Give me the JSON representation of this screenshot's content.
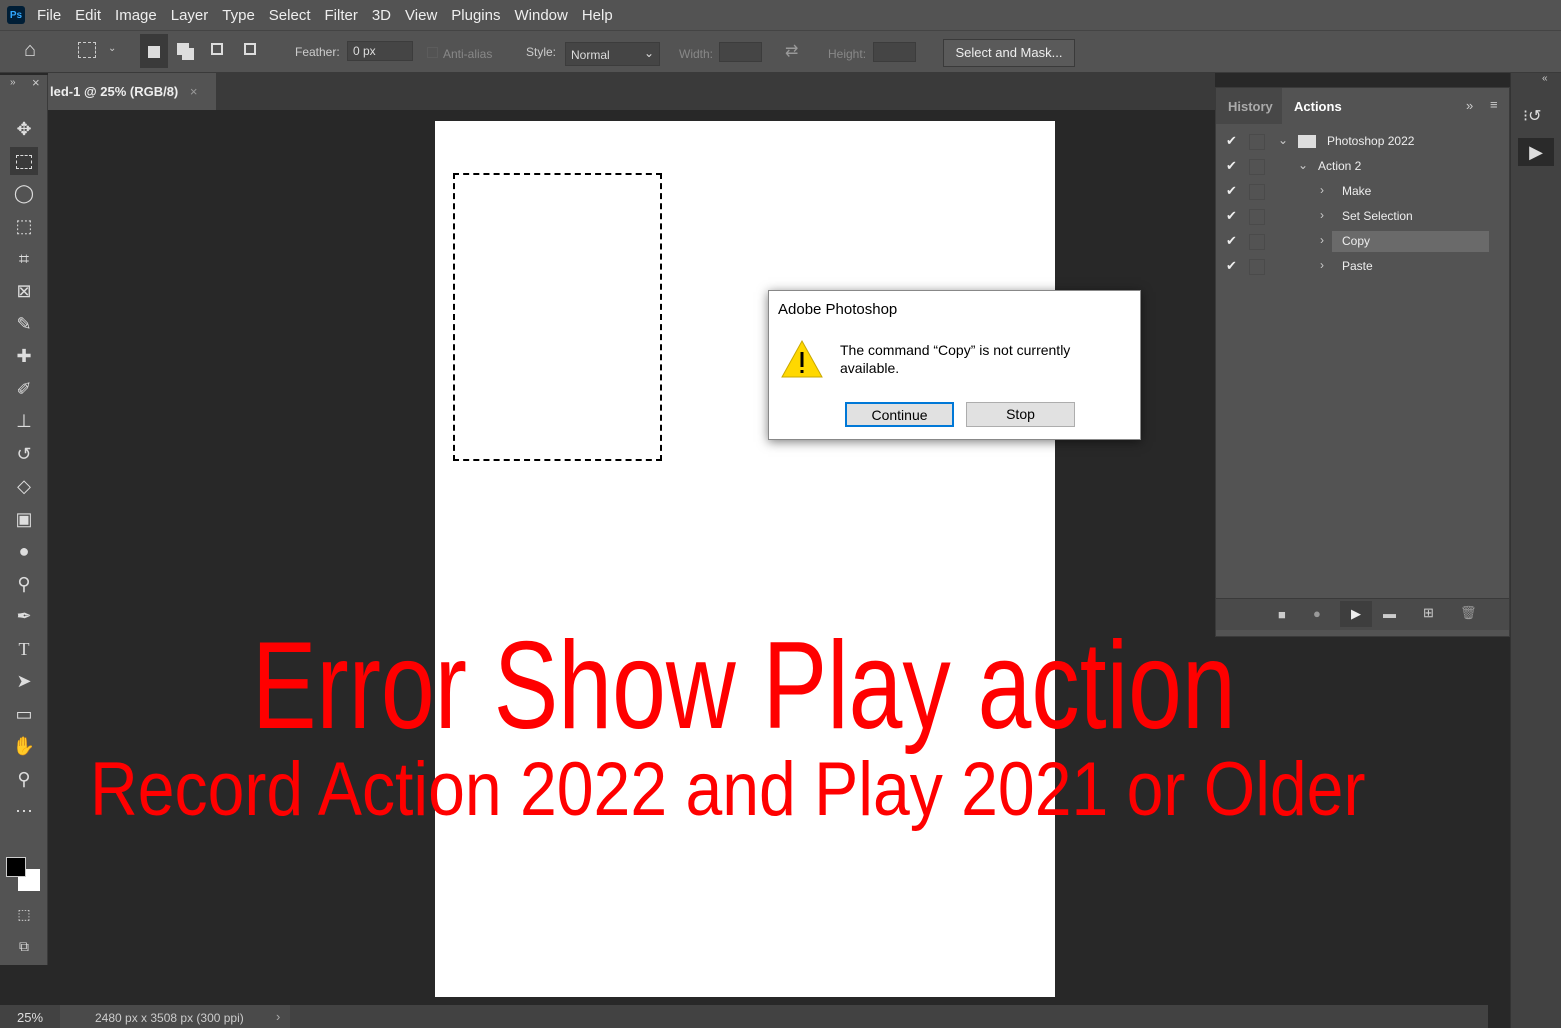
{
  "menu": [
    "File",
    "Edit",
    "Image",
    "Layer",
    "Type",
    "Select",
    "Filter",
    "3D",
    "View",
    "Plugins",
    "Window",
    "Help"
  ],
  "app_badge": "Ps",
  "options": {
    "feather_label": "Feather:",
    "feather_value": "0 px",
    "antialias_label": "Anti-alias",
    "style_label": "Style:",
    "style_value": "Normal",
    "width_label": "Width:",
    "height_label": "Height:",
    "select_mask": "Select and Mask..."
  },
  "document_tab": {
    "title": "led-1 @ 25% (RGB/8)",
    "close": "×"
  },
  "panel": {
    "tabs": [
      "History",
      "Actions"
    ],
    "items": [
      {
        "label": "Photoshop 2022",
        "level": 0,
        "expanded": true,
        "type": "set"
      },
      {
        "label": "Action 2",
        "level": 1,
        "expanded": true,
        "type": "action"
      },
      {
        "label": "Make",
        "level": 2,
        "type": "command"
      },
      {
        "label": "Set Selection",
        "level": 2,
        "type": "command"
      },
      {
        "label": "Copy",
        "level": 2,
        "type": "command",
        "selected": true
      },
      {
        "label": "Paste",
        "level": 2,
        "type": "command"
      }
    ]
  },
  "dialog": {
    "title": "Adobe Photoshop",
    "message": "The command “Copy” is not currently available.",
    "continue": "Continue",
    "stop": "Stop"
  },
  "status": {
    "zoom": "25%",
    "doc_info": "2480 px x 3508 px (300 ppi)"
  },
  "overlay": {
    "line1": "Error Show Play action",
    "line2": "Record Action 2022 and Play 2021 or Older",
    "color": "#ff0000"
  }
}
